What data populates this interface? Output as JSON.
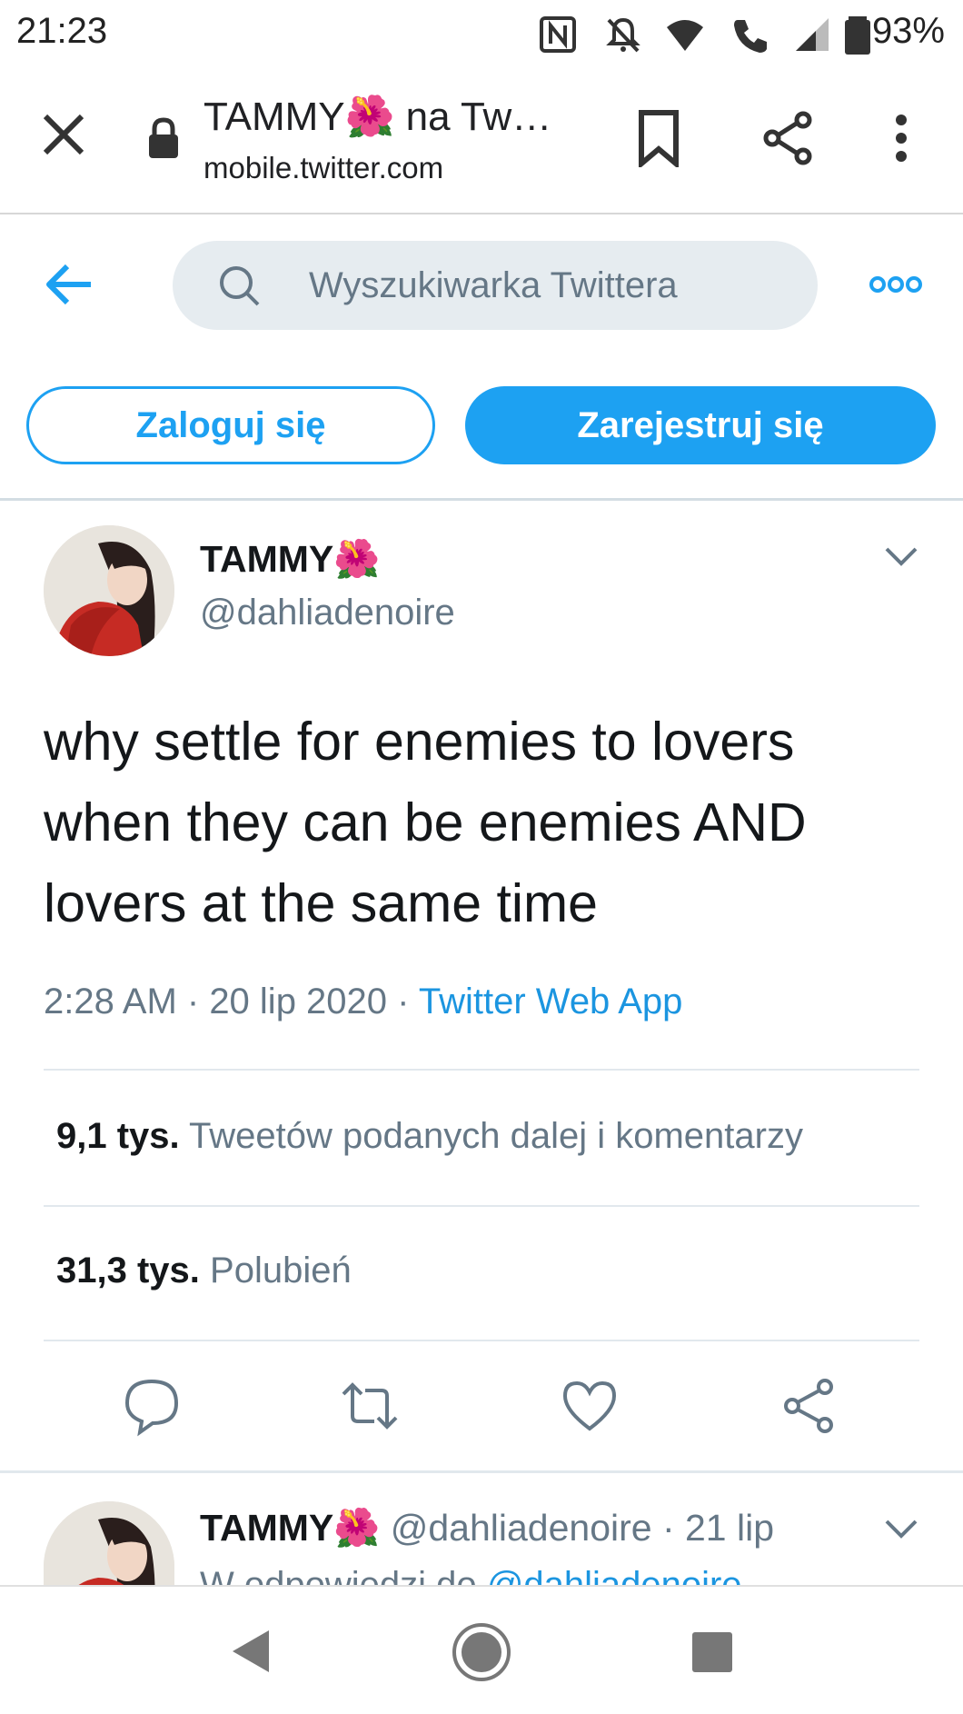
{
  "status_bar": {
    "time": "21:23",
    "battery": "93%",
    "icons": [
      "nfc-icon",
      "notifications-off-icon",
      "wifi-icon",
      "wifi-calling-icon",
      "signal-icon",
      "battery-icon"
    ]
  },
  "browser": {
    "title_prefix": "TAMMY",
    "title_emoji": "🌺",
    "title_suffix": " na Tw…",
    "url": "mobile.twitter.com"
  },
  "twitter_header": {
    "search_placeholder": "Wyszukiwarka Twittera",
    "login_label": "Zaloguj się",
    "register_label": "Zarejestruj się"
  },
  "tweet": {
    "author_name": "TAMMY",
    "author_emoji": "🌺",
    "handle": "@dahliadenoire",
    "text": "why settle for enemies to lovers when they can be enemies AND lovers at the same time",
    "time": "2:28 AM",
    "date": "20 lip 2020",
    "source": "Twitter Web App",
    "retweets_count": "9,1 tys.",
    "retweets_label": "Tweetów podanych dalej i komentarzy",
    "likes_count": "31,3 tys.",
    "likes_label": "Polubień"
  },
  "reply": {
    "author_name": "TAMMY",
    "author_emoji": "🌺",
    "handle": "@dahliadenoire",
    "date": "21 lip",
    "in_reply_prefix": "W odpowiedzi do ",
    "in_reply_mention": "@dahliadenoire"
  },
  "colors": {
    "twitter_blue": "#1da1f2",
    "link_blue": "#1b95e0",
    "muted_text": "#657786",
    "search_bg": "#e6ecf0"
  }
}
